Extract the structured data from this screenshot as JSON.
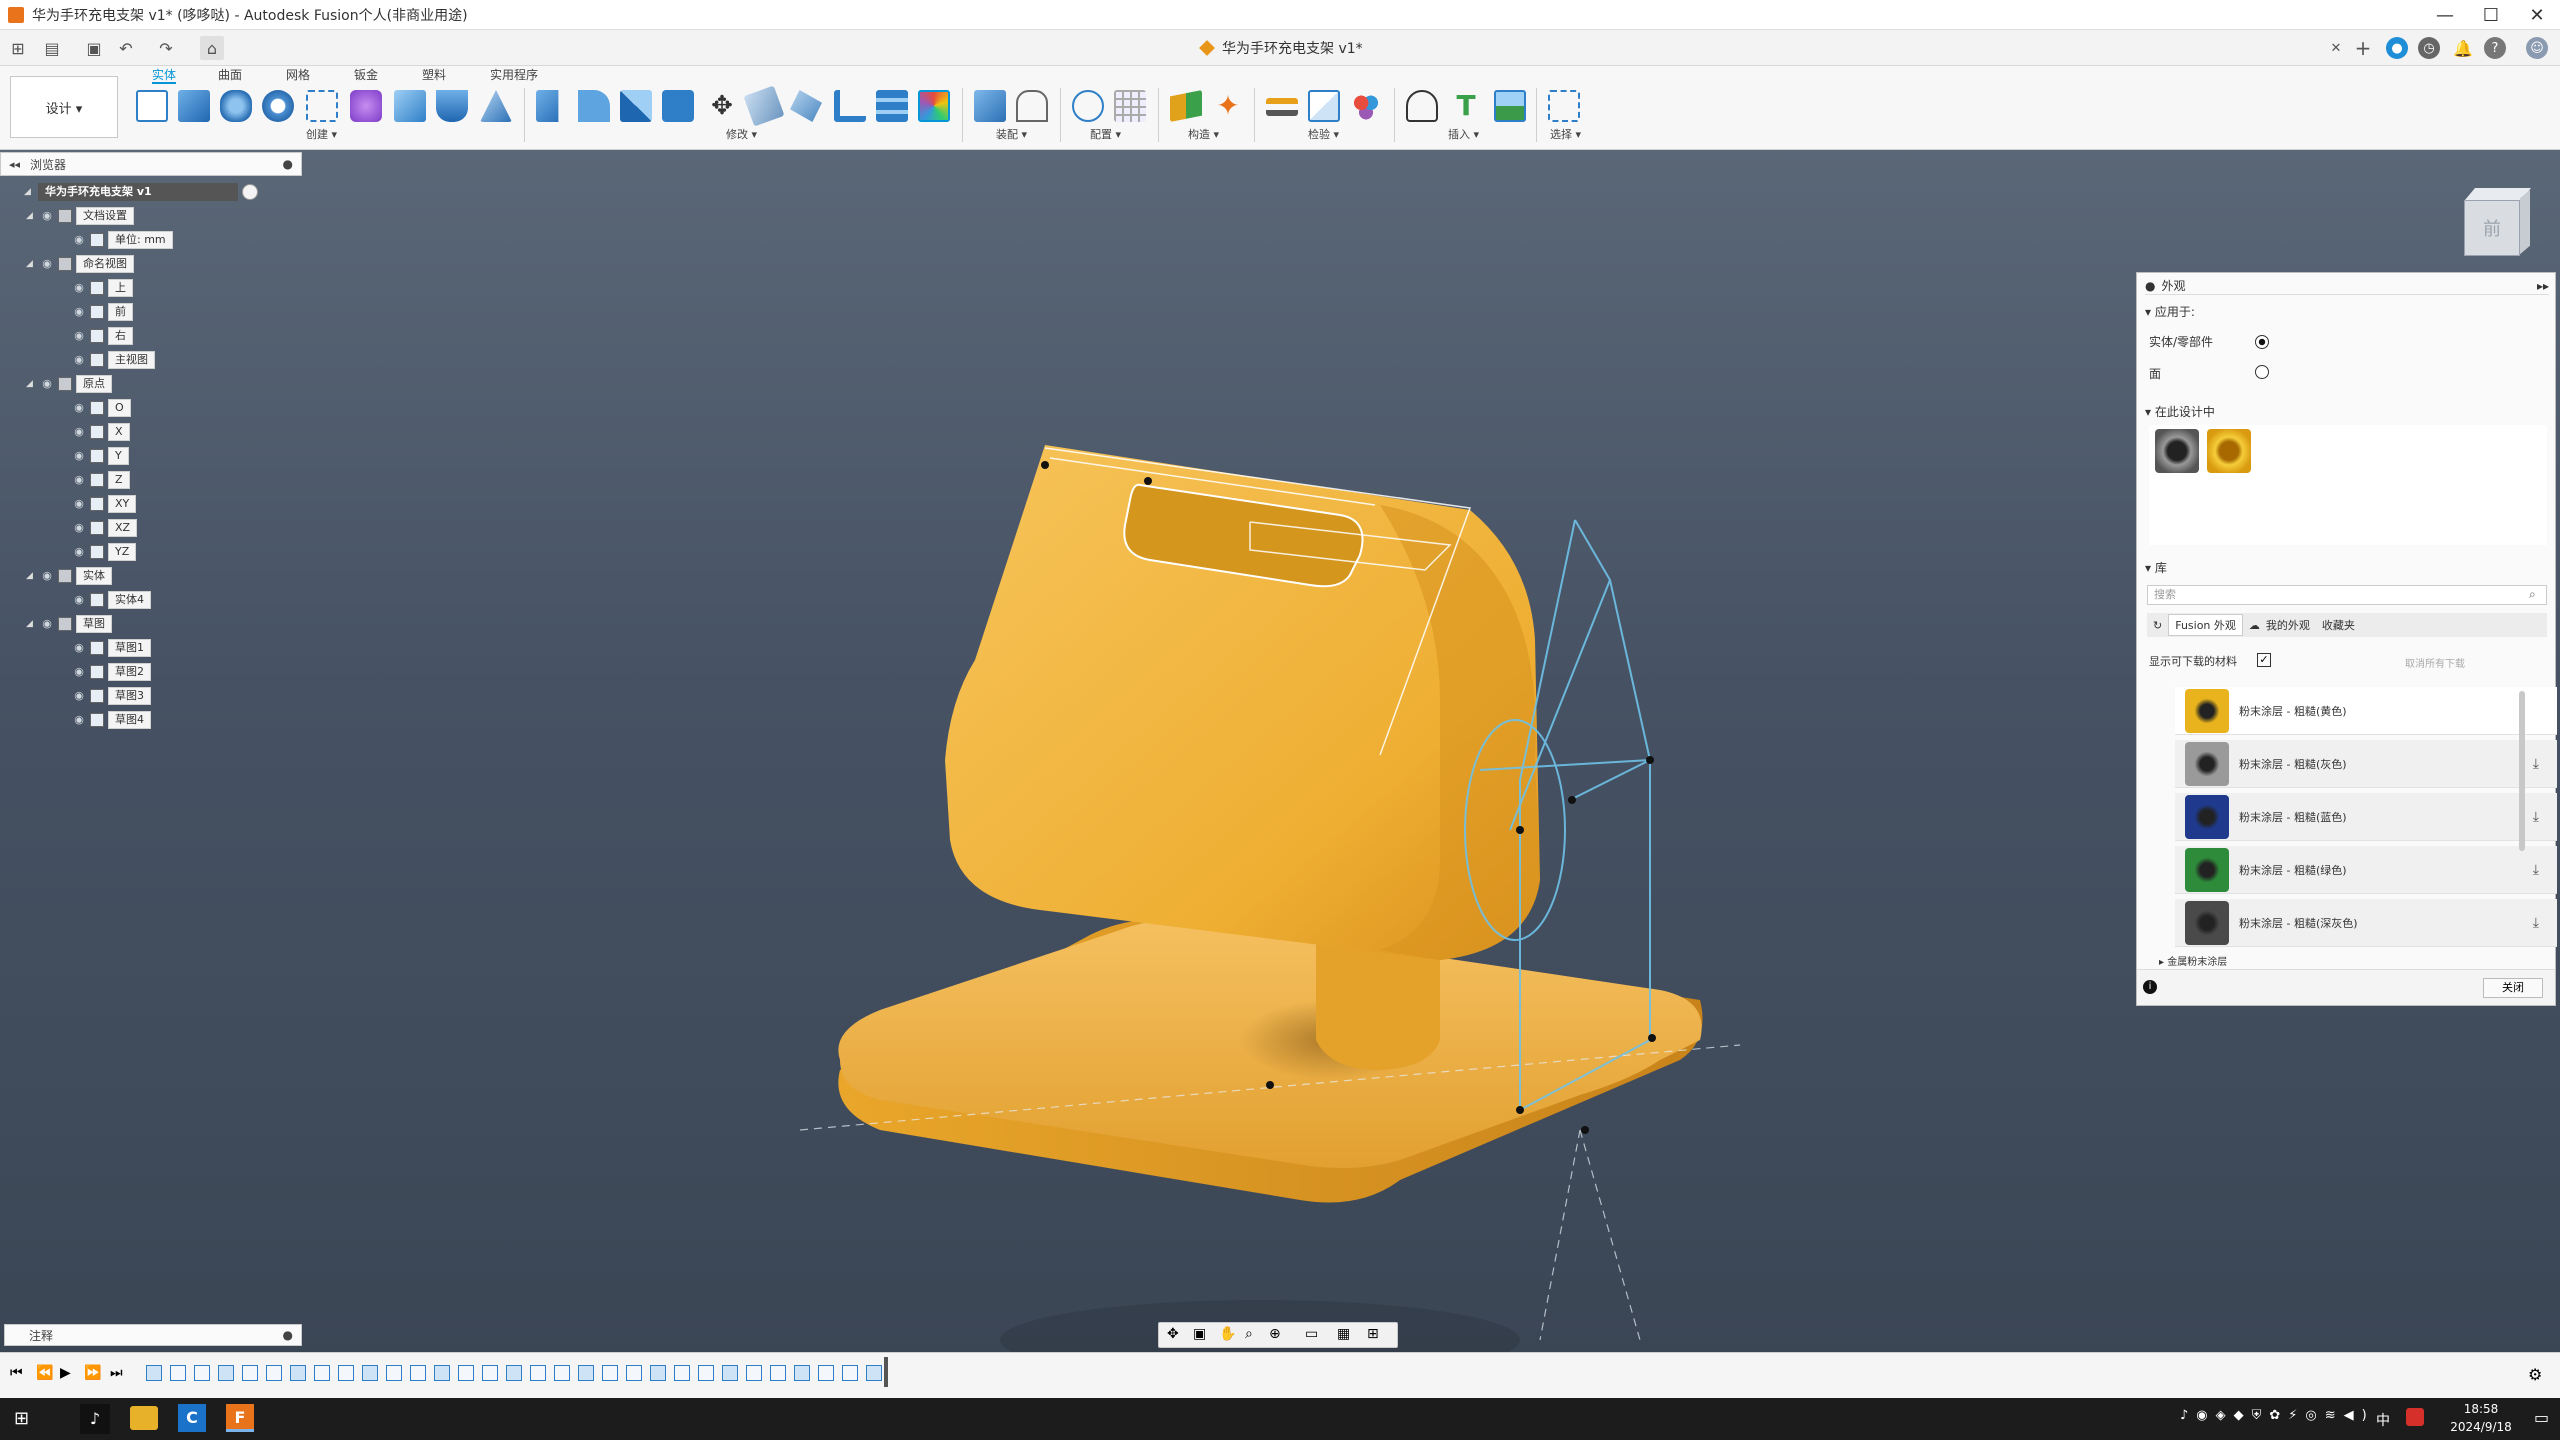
{
  "window": {
    "title": "华为手环充电支架 v1* (哆哆哒) - Autodesk Fusion个人(非商业用途)"
  },
  "document": {
    "tab_title": "华为手环充电支架 v1*"
  },
  "workspace": {
    "label": "设计 ▾"
  },
  "ribbon": {
    "tabs": [
      "实体",
      "曲面",
      "网格",
      "钣金",
      "塑料",
      "实用程序"
    ],
    "groups": [
      "创建 ▾",
      "修改 ▾",
      "装配 ▾",
      "配置 ▾",
      "构造 ▾",
      "检验 ▾",
      "插入 ▾",
      "选择 ▾"
    ]
  },
  "browser": {
    "title": "浏览器",
    "root": "华为手环充电支架 v1",
    "items": [
      {
        "label": "文档设置",
        "level": 1
      },
      {
        "label": "单位: mm",
        "level": 2
      },
      {
        "label": "命名视图",
        "level": 1
      },
      {
        "label": "上",
        "level": 2
      },
      {
        "label": "前",
        "level": 2
      },
      {
        "label": "右",
        "level": 2
      },
      {
        "label": "主视图",
        "level": 2
      },
      {
        "label": "原点",
        "level": 1
      },
      {
        "label": "O",
        "level": 2
      },
      {
        "label": "X",
        "level": 2
      },
      {
        "label": "Y",
        "level": 2
      },
      {
        "label": "Z",
        "level": 2
      },
      {
        "label": "XY",
        "level": 2
      },
      {
        "label": "XZ",
        "level": 2
      },
      {
        "label": "YZ",
        "level": 2
      },
      {
        "label": "实体",
        "level": 1
      },
      {
        "label": "实体4",
        "level": 2
      },
      {
        "label": "草图",
        "level": 1
      },
      {
        "label": "草图1",
        "level": 2
      },
      {
        "label": "草图2",
        "level": 2
      },
      {
        "label": "草图3",
        "level": 2
      },
      {
        "label": "草图4",
        "level": 2
      }
    ]
  },
  "viewcube": {
    "face": "前"
  },
  "appearance_panel": {
    "title": "外观",
    "apply_to_label": "应用于:",
    "apply_options": [
      "实体/零部件",
      "面"
    ],
    "in_design_label": "在此设计中",
    "library_label": "库",
    "search_placeholder": "搜索",
    "lib_tabs": [
      "Fusion 外观",
      "我的外观",
      "收藏夹"
    ],
    "show_downloadable": "显示可下载的材料",
    "cancel_all": "取消所有下载",
    "materials": [
      {
        "name": "粉末涂层 - 粗糙(黄色)",
        "color": "#e8b31c",
        "downloadable": false
      },
      {
        "name": "粉末涂层 - 粗糙(灰色)",
        "color": "#9a9a9a",
        "downloadable": true
      },
      {
        "name": "粉末涂层 - 粗糙(蓝色)",
        "color": "#1f3a8c",
        "downloadable": true
      },
      {
        "name": "粉末涂层 - 粗糙(绿色)",
        "color": "#2e8b3a",
        "downloadable": true
      },
      {
        "name": "粉末涂层 - 粗糙(深灰色)",
        "color": "#4a4a4a",
        "downloadable": true
      }
    ],
    "folder": "金属粉末涂层",
    "close_label": "关闭"
  },
  "selection_bar": {
    "label": "注释"
  },
  "taskbar": {
    "time": "18:58",
    "date": "2024/9/18",
    "ime": "中"
  }
}
